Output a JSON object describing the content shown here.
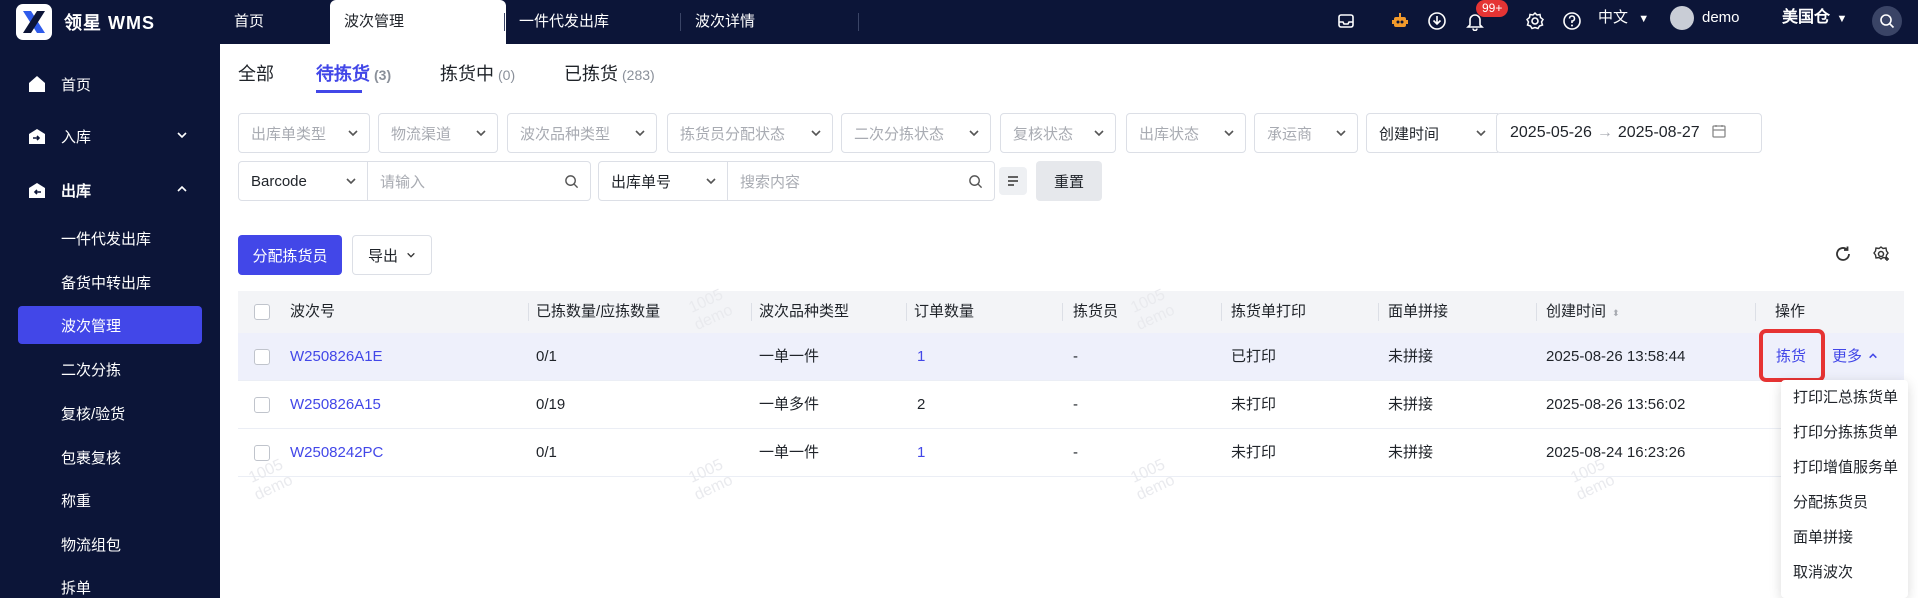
{
  "app": {
    "name": "领星 WMS"
  },
  "top_nav": {
    "tabs": [
      {
        "label": "首页"
      },
      {
        "label": "波次管理"
      },
      {
        "label": "一件代发出库"
      },
      {
        "label": "波次详情"
      }
    ],
    "notification_count": "99+",
    "language": "中文",
    "user": "demo",
    "warehouse": "美国仓"
  },
  "sidebar": {
    "items": [
      {
        "label": "首页",
        "icon": "home-icon"
      },
      {
        "label": "入库",
        "icon": "inbound-icon"
      },
      {
        "label": "出库",
        "icon": "outbound-icon"
      }
    ],
    "sub_items": [
      {
        "label": "一件代发出库"
      },
      {
        "label": "备货中转出库"
      },
      {
        "label": "波次管理"
      },
      {
        "label": "二次分拣"
      },
      {
        "label": "复核/验货"
      },
      {
        "label": "包裹复核"
      },
      {
        "label": "称重"
      },
      {
        "label": "物流组包"
      },
      {
        "label": "拆单"
      }
    ]
  },
  "status_tabs": [
    {
      "label": "全部",
      "count": ""
    },
    {
      "label": "待拣货",
      "count": "(3)"
    },
    {
      "label": "拣货中",
      "count": "(0)"
    },
    {
      "label": "已拣货",
      "count": "(283)"
    }
  ],
  "filters": {
    "row1": [
      {
        "label": "出库单类型"
      },
      {
        "label": "物流渠道"
      },
      {
        "label": "波次品种类型"
      },
      {
        "label": "拣货员分配状态"
      },
      {
        "label": "二次分拣状态"
      },
      {
        "label": "复核状态"
      },
      {
        "label": "出库状态"
      },
      {
        "label": "承运商"
      }
    ],
    "date_type": "创建时间",
    "date_start": "2025-05-26",
    "date_end": "2025-08-27",
    "barcode_select": "Barcode",
    "barcode_placeholder": "请输入",
    "order_select": "出库单号",
    "search_placeholder": "搜索内容",
    "reset_label": "重置"
  },
  "toolbar": {
    "assign_label": "分配拣货员",
    "export_label": "导出"
  },
  "table": {
    "headers": [
      "波次号",
      "已拣数量/应拣数量",
      "波次品种类型",
      "订单数量",
      "拣货员",
      "拣货单打印",
      "面单拼接",
      "创建时间",
      "操作"
    ],
    "rows": [
      {
        "wave_no": "W250826A1E",
        "qty": "0/1",
        "variety": "一单一件",
        "orders": "1",
        "picker": "-",
        "print": "已打印",
        "splice": "未拼接",
        "created": "2025-08-26 13:58:44"
      },
      {
        "wave_no": "W250826A15",
        "qty": "0/19",
        "variety": "一单多件",
        "orders": "2",
        "picker": "-",
        "print": "未打印",
        "splice": "未拼接",
        "created": "2025-08-26 13:56:02"
      },
      {
        "wave_no": "W2508242PC",
        "qty": "0/1",
        "variety": "一单一件",
        "orders": "1",
        "picker": "-",
        "print": "未打印",
        "splice": "未拼接",
        "created": "2025-08-24 16:23:26"
      }
    ],
    "pick_label": "拣货",
    "more_label": "更多"
  },
  "more_menu": [
    {
      "label": "打印汇总拣货单"
    },
    {
      "label": "打印分拣拣货单"
    },
    {
      "label": "打印增值服务单"
    },
    {
      "label": "分配拣货员"
    },
    {
      "label": "面单拼接"
    },
    {
      "label": "取消波次"
    }
  ],
  "watermark": {
    "line1": "1005",
    "line2": "demo"
  },
  "colors": {
    "primary": "#4247e8",
    "nav_bg": "#0c1538",
    "highlight": "#e63333",
    "badge": "#e53434"
  }
}
